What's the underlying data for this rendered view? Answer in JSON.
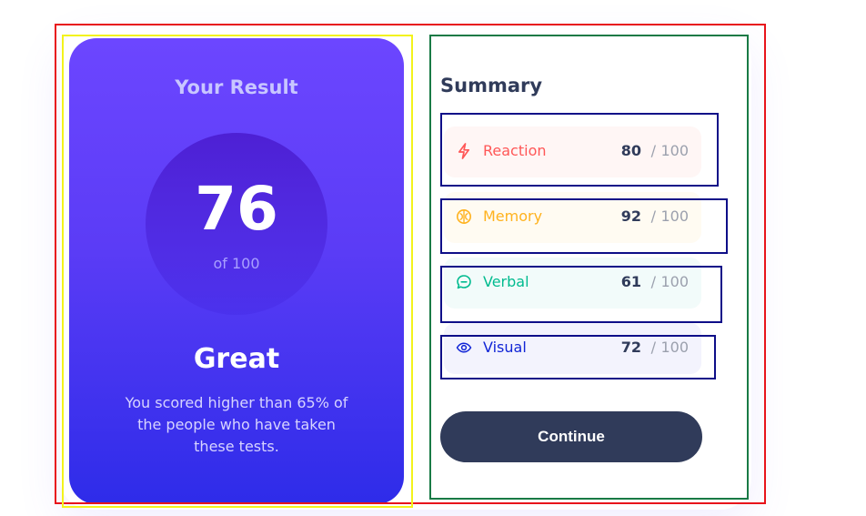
{
  "result": {
    "title": "Your Result",
    "score": "76",
    "score_of": "of 100",
    "rating": "Great",
    "description": "You scored higher than 65% of the people who have taken these tests."
  },
  "summary": {
    "title": "Summary",
    "items": [
      {
        "label": "Reaction",
        "score": "80",
        "separator": "/",
        "max": "100",
        "icon": "lightning-icon",
        "accent_color": "#ff5757",
        "background_color": "#fff6f5"
      },
      {
        "label": "Memory",
        "score": "92",
        "separator": "/",
        "max": "100",
        "icon": "brain-icon",
        "accent_color": "#ffb21e",
        "background_color": "#fffbf2"
      },
      {
        "label": "Verbal",
        "score": "61",
        "separator": "/",
        "max": "100",
        "icon": "chat-bubble-icon",
        "accent_color": "#00bb8f",
        "background_color": "#f2fbfa"
      },
      {
        "label": "Visual",
        "score": "72",
        "separator": "/",
        "max": "100",
        "icon": "eye-icon",
        "accent_color": "#1125d6",
        "background_color": "#f3f3fd"
      }
    ]
  },
  "actions": {
    "continue_label": "Continue"
  },
  "colors": {
    "primary_gradient_top": "#6c46ff",
    "primary_gradient_bottom": "#2e2ce9",
    "dark_navy": "#303b5a",
    "outer_annotation": "#e8141b",
    "left_annotation": "#f3f31b",
    "right_annotation": "#197a45",
    "item_annotation": "#0e0e88"
  }
}
